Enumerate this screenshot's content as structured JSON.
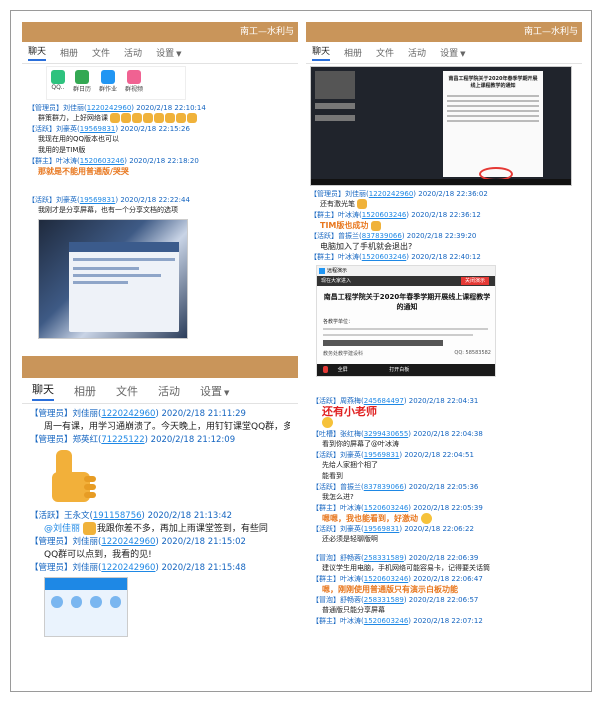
{
  "panels": {
    "tl": {
      "header": "南工—水利与",
      "tabs": [
        "聊天",
        "相册",
        "文件",
        "活动",
        "设置"
      ],
      "apps": [
        "QQ..",
        "群日历",
        "群作业",
        "群视频"
      ],
      "messages": [
        {
          "role": "【管理员】",
          "name": "刘佳丽",
          "qq": "1220242960",
          "time": "2020/2/18 22:10:14",
          "text": "群策群力，上好网络课"
        },
        {
          "role": "【活跃】",
          "name": "刘豪英",
          "qq": "19569831",
          "time": "2020/2/18 22:15:26",
          "lines": [
            "我现在用的QQ版本也可以",
            "我用的是TIM版"
          ]
        },
        {
          "role": "【群主】",
          "name": "叶冰涛",
          "qq": "1520603246",
          "time": "2020/2/18 22:18:20",
          "text": "那就是不能用普通版/哭哭"
        },
        {
          "role": "【活跃】",
          "name": "刘豪英",
          "qq": "19569831",
          "time": "2020/2/18 22:22:44",
          "text": "我刚才是分享屏幕，也有一个分享文档的选项"
        }
      ]
    },
    "tr": {
      "header": "南工—水利与",
      "tabs": [
        "聊天",
        "相册",
        "文件",
        "活动",
        "设置"
      ],
      "doc_title": "南昌工程学院关于2020年春季学期开展线上课程教学的通知",
      "messages": [
        {
          "role": "【管理员】",
          "name": "刘佳丽",
          "qq": "1220242960",
          "time": "2020/2/18 22:36:02",
          "text": "还有激光笔"
        },
        {
          "role": "【群主】",
          "name": "叶冰涛",
          "qq": "1520603246",
          "time": "2020/2/18 22:36:12",
          "text": "TIM版也成功"
        },
        {
          "role": "【活跃】",
          "name": "曾振兰",
          "qq": "837839066",
          "time": "2020/2/18 22:39:20",
          "text": "电脑加入了手机就会退出?"
        },
        {
          "role": "【群主】",
          "name": "叶冰涛",
          "qq": "1520603246",
          "time": "2020/2/18 22:40:12"
        }
      ],
      "share": {
        "title": "远程演示",
        "banner": "现在大家进入",
        "close": "关闭演示",
        "doc": "南昌工程学院关于2020年春季学期开展线上课程教学的通知",
        "greeting": "各教学单位：",
        "bottom": "教务处教学建设科",
        "qq": "QQ: 58583582",
        "whiteboard": "打开白板",
        "fullscreen": "全屏"
      }
    },
    "bl": {
      "header": "",
      "tabs": [
        "聊天",
        "相册",
        "文件",
        "活动",
        "设置"
      ],
      "messages": [
        {
          "role": "【管理员】",
          "name": "刘佳丽",
          "qq": "1220242960",
          "time": "2020/2/18 21:11:29",
          "text": "周一有课，用学习通崩溃了。今天晚上，用钉钉课堂QQ群，多人通"
        },
        {
          "role": "【管理员】",
          "name": "郑英红",
          "qq": "71225122",
          "time": "2020/2/18 21:12:09"
        },
        {
          "role": "【活跃】",
          "name": "王永文",
          "qq": "191158756",
          "time": "2020/2/18 21:13:42",
          "mention": "@刘佳丽",
          "text": "我跟你差不多，再加上雨课堂签到，有些同"
        },
        {
          "role": "【管理员】",
          "name": "刘佳丽",
          "qq": "1220242960",
          "time": "2020/2/18 21:15:02",
          "text": "QQ群可以点到，我看的见!"
        },
        {
          "role": "【管理员】",
          "name": "刘佳丽",
          "qq": "1220242960",
          "time": "2020/2/18 21:15:48"
        }
      ]
    },
    "br": {
      "messages": [
        {
          "role": "【活跃】",
          "name": "周燕梅",
          "qq": "245684497",
          "time": "2020/2/18 22:04:31",
          "text": "还有小老师",
          "style": "red"
        },
        {
          "role": "【吐槽】",
          "name": "张红梅",
          "qq": "3299430655",
          "time": "2020/2/18 22:04:38",
          "text": "看到你的屏幕了@叶冰涛"
        },
        {
          "role": "【活跃】",
          "name": "刘豪英",
          "qq": "19569831",
          "time": "2020/2/18 22:04:51",
          "lines": [
            "先给人家捆个相了",
            "能看到"
          ]
        },
        {
          "role": "【活跃】",
          "name": "曾振兰",
          "qq": "837839066",
          "time": "2020/2/18 22:05:36",
          "text": "我怎么进?"
        },
        {
          "role": "【群主】",
          "name": "叶冰涛",
          "qq": "1520603246",
          "time": "2020/2/18 22:05:39",
          "text": "嗯嗯，我也能看到，好激动",
          "style": "orange"
        },
        {
          "role": "【活跃】",
          "name": "刘豪英",
          "qq": "19569831",
          "time": "2020/2/18 22:06:22",
          "text": "还必须是轻聊版啊"
        },
        {
          "role": "【冒泡】",
          "name": "舒畅蓉",
          "qq": "258331589",
          "time": "2020/2/18 22:06:39",
          "text": "建议学生用电脑，手机网络可能容易卡，记得要关话筒"
        },
        {
          "role": "【群主】",
          "name": "叶冰涛",
          "qq": "1520603246",
          "time": "2020/2/18 22:06:47",
          "text": "嗯，刚刚使用普通版只有演示白板功能",
          "style": "orange"
        },
        {
          "role": "【冒泡】",
          "name": "舒畅蓉",
          "qq": "258331589",
          "time": "2020/2/18 22:06:57",
          "text": "普通版只能分享屏幕"
        },
        {
          "role": "【群主】",
          "name": "叶冰涛",
          "qq": "1520603246",
          "time": "2020/2/18 22:07:12"
        }
      ]
    }
  }
}
